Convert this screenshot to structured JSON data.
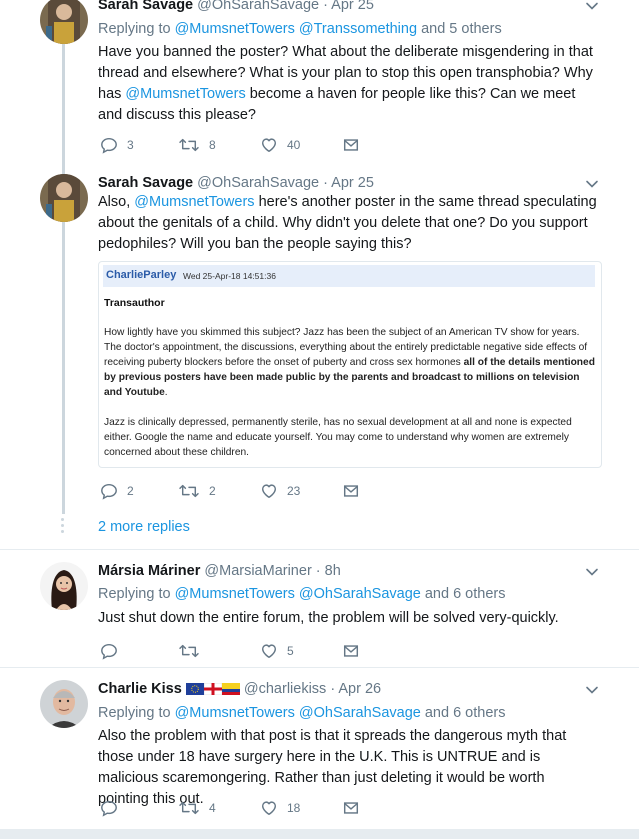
{
  "tweets": [
    {
      "name": "Sarah Savage",
      "handle": "@OhSarahSavage · Apr 25",
      "replying_prefix": "Replying to ",
      "reply_links": [
        "@MumsnetTowers",
        "@Transsomething"
      ],
      "reply_suffix": " and 5 others",
      "text_parts": [
        "Have you banned the poster? What about the deliberate misgendering in that thread and elsewhere? What is your plan to stop this open transphobia? Why has ",
        "@MumsnetTowers",
        " become a haven for people like this? Can we meet and discuss this please?"
      ],
      "reply_count": "3",
      "retweet_count": "8",
      "like_count": "40"
    },
    {
      "name": "Sarah Savage",
      "handle": "@OhSarahSavage · Apr 25",
      "text_parts": [
        "Also, ",
        "@MumsnetTowers",
        " here's another poster in the same thread speculating about the genitals of a child. Why didn't you delete that one? Do you support pedophiles? Will you ban the people saying this?"
      ],
      "quote": {
        "user": "CharlieParley",
        "date": "Wed 25-Apr-18 14:51:36",
        "title": "Transauthor",
        "p1": "How lightly have you skimmed this subject? Jazz has been the subject of an American TV show for years. The doctor's appointment, the discussions, everything about the entirely predictable negative side effects of receiving puberty blockers before the onset of puberty and cross sex hormones ",
        "p1_bold": "all of the details mentioned by previous posters have been made public by the parents and broadcast to millions on television and Youtube",
        "p1_end": ".",
        "p2": "Jazz is clinically depressed, permanently sterile, has no sexual development at all and none is expected either. Google the name and educate yourself. You may come to understand why women are extremely concerned about these children."
      },
      "reply_count": "2",
      "retweet_count": "2",
      "like_count": "23",
      "more_replies": "2 more replies"
    },
    {
      "name": "Mársia Máriner",
      "handle": "@MarsiaMariner · 8h",
      "replying_prefix": "Replying to ",
      "reply_links": [
        "@MumsnetTowers",
        "@OhSarahSavage"
      ],
      "reply_suffix": " and 6 others",
      "text": "Just shut down the entire forum, the problem will be solved very-quickly.",
      "like_count": "5"
    },
    {
      "name": "Charlie Kiss",
      "handle": "@charliekiss · Apr 26",
      "replying_prefix": "Replying to ",
      "reply_links": [
        "@MumsnetTowers",
        "@OhSarahSavage"
      ],
      "reply_suffix": " and 6 others",
      "text": "Also the problem with that post is that it spreads the dangerous myth that those under 18 have surgery here in the U.K. This is UNTRUE and is malicious scaremongering. Rather than just deleting it would be worth pointing this out.",
      "retweet_count": "4",
      "like_count": "18"
    }
  ],
  "colors": {
    "link": "#1b95e0",
    "muted": "#657786",
    "line": "#ccd6dd"
  },
  "icons": [
    "reply-icon",
    "retweet-icon",
    "like-icon",
    "message-icon",
    "chevron-down-icon"
  ]
}
